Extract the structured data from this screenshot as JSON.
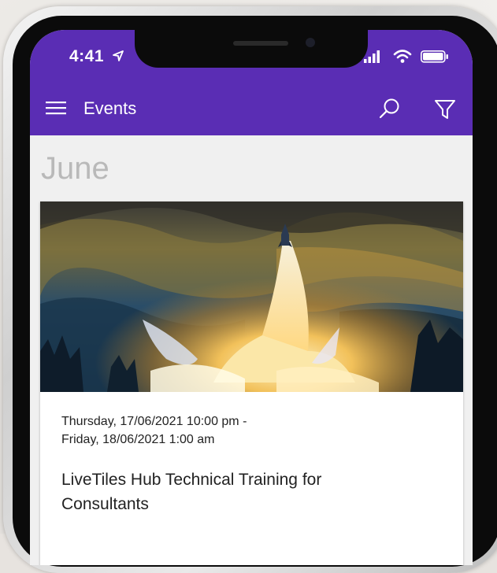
{
  "status_bar": {
    "time": "4:41"
  },
  "appbar": {
    "title": "Events"
  },
  "month": {
    "label": "June"
  },
  "event": {
    "date_line1": "Thursday, 17/06/2021 10:00 pm -",
    "date_line2": "Friday, 18/06/2021 1:00 am",
    "title_line1": "LiveTiles Hub Technical Training for",
    "title_line2": "Consultants"
  },
  "icons": {
    "menu": "menu-icon",
    "search": "search-icon",
    "filter": "filter-icon",
    "location": "location-arrow-icon",
    "signal": "cellular-signal-icon",
    "wifi": "wifi-icon",
    "battery": "battery-icon"
  },
  "colors": {
    "appbar": "#5a2db4",
    "month_text": "#b9b9b9",
    "background": "#f0f0f0"
  }
}
